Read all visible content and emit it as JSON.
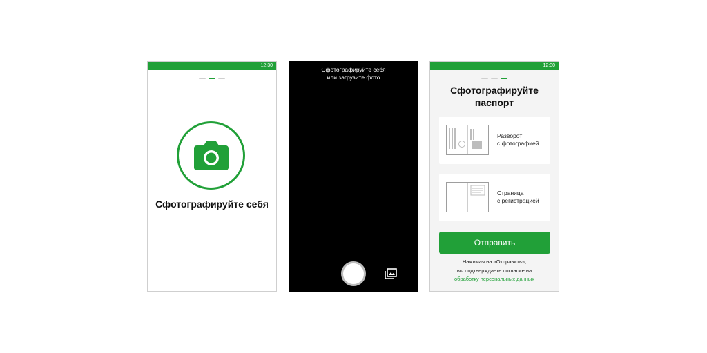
{
  "screen1": {
    "status_time": "12:30",
    "title": "Сфотографируйте себя",
    "steps": [
      false,
      true,
      false
    ],
    "icon": "camera-icon"
  },
  "screen2": {
    "hint_line1": "Сфотографируйте себя",
    "hint_line2": "или загрузите фото",
    "shutter_icon": "shutter-button",
    "gallery_icon": "gallery-icon"
  },
  "screen3": {
    "status_time": "12:30",
    "steps": [
      false,
      false,
      true
    ],
    "title_line1": "Сфотографируйте",
    "title_line2": "паспорт",
    "cards": [
      {
        "line1": "Разворот",
        "line2": "с фотографией",
        "icon": "passport-photo-spread-icon"
      },
      {
        "line1": "Страница",
        "line2": "с регистрацией",
        "icon": "passport-registration-page-icon"
      }
    ],
    "send_label": "Отправить",
    "consent_line1": "Нажимая на «Отправить»,",
    "consent_line2": "вы подтверждаете согласие на",
    "consent_link": "обработку персональных данных"
  },
  "colors": {
    "accent": "#21a038",
    "camera_bg": "#000000",
    "panel_bg": "#f4f4f4"
  }
}
